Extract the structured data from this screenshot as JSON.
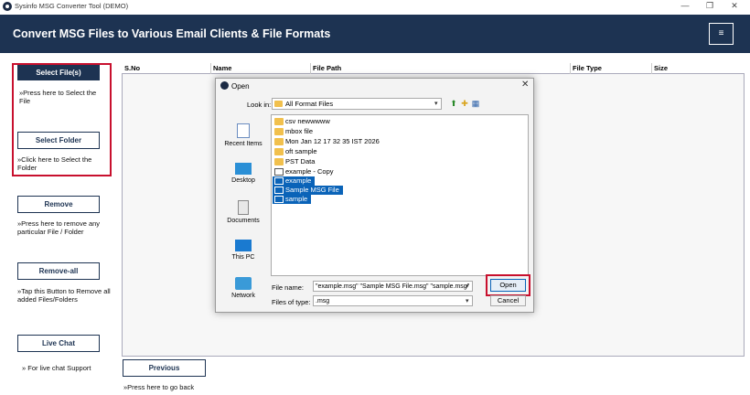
{
  "window": {
    "title": "Sysinfo MSG Converter Tool (DEMO)",
    "minimize": "—",
    "maximize": "❐",
    "close": "✕"
  },
  "header": {
    "title": "Convert MSG Files to Various Email Clients & File Formats",
    "menu_icon": "≡"
  },
  "left_panel": {
    "select_files": {
      "label": "Select File(s)",
      "hint": "»Press here to Select the File"
    },
    "select_folder": {
      "label": "Select Folder",
      "hint": "»Click here to Select the Folder"
    },
    "remove": {
      "label": "Remove",
      "hint": "»Press here to remove any particular File / Folder"
    },
    "remove_all": {
      "label": "Remove-all",
      "hint": "»Tap this Button to Remove all added Files/Folders"
    },
    "live_chat": {
      "label": "Live Chat",
      "hint": "» For live chat Support"
    }
  },
  "table": {
    "columns": [
      "S.No",
      "Name",
      "File Path",
      "File Type",
      "Size"
    ]
  },
  "bottom": {
    "previous": {
      "label": "Previous",
      "hint": "»Press here to go back"
    }
  },
  "dialog": {
    "title": "Open",
    "close": "✕",
    "look_in_label": "Look in:",
    "look_in_value": "All Format Files",
    "places": [
      "Recent Items",
      "Desktop",
      "Documents",
      "This PC",
      "Network"
    ],
    "files": [
      {
        "name": "csv newwwww",
        "type": "folder",
        "selected": false
      },
      {
        "name": "mbox file",
        "type": "folder",
        "selected": false
      },
      {
        "name": "Mon Jan 12 17 32 35 IST 2026",
        "type": "folder",
        "selected": false
      },
      {
        "name": "oft sample",
        "type": "folder",
        "selected": false
      },
      {
        "name": "PST Data",
        "type": "folder",
        "selected": false
      },
      {
        "name": "example - Copy",
        "type": "msg",
        "selected": false
      },
      {
        "name": "example",
        "type": "msg",
        "selected": true
      },
      {
        "name": "Sample MSG File",
        "type": "msg",
        "selected": true
      },
      {
        "name": "sample",
        "type": "msg",
        "selected": true
      }
    ],
    "file_name_label": "File name:",
    "file_name_value": "\"example.msg\" \"Sample MSG File.msg\" \"sample.msg\"",
    "files_of_type_label": "Files of type:",
    "files_of_type_value": ".msg",
    "open_label": "Open",
    "cancel_label": "Cancel"
  },
  "colors": {
    "header_bg": "#1d3352",
    "highlight_red": "#c8102e",
    "selection_blue": "#0a63b8"
  }
}
